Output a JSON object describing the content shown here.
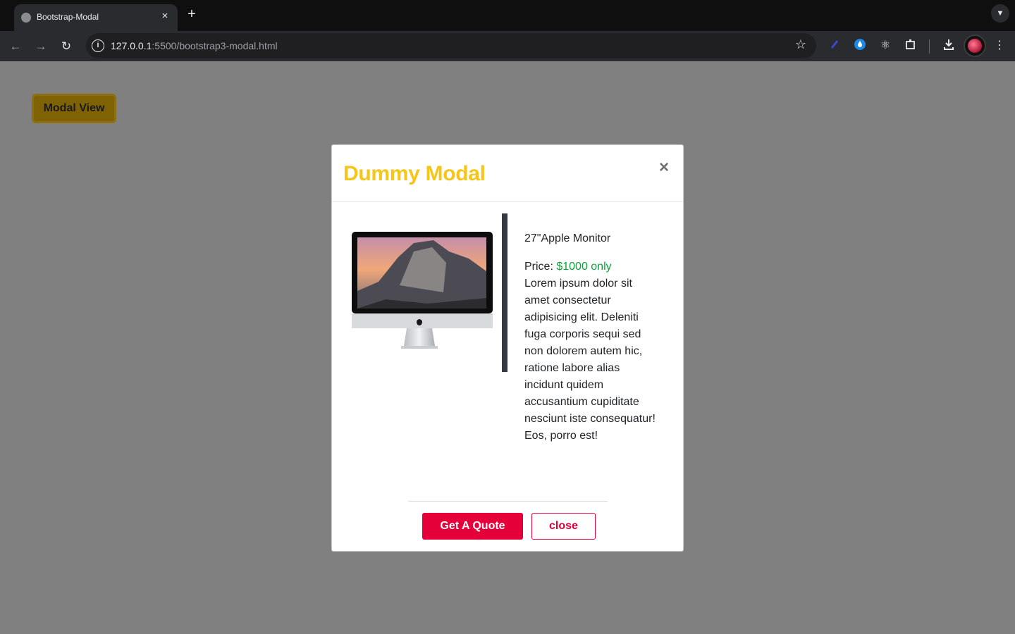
{
  "browser": {
    "tab_title": "Bootstrap-Modal",
    "tab_close": "×",
    "new_tab": "+",
    "url_host": "127.0.0.1",
    "url_rest": ":5500/bootstrap3-modal.html",
    "icons": [
      "back-icon",
      "forward-icon",
      "reload-icon",
      "info-icon",
      "star-icon",
      "pen-extension-icon",
      "drop-extension-icon",
      "react-extension-icon",
      "extensions-puzzle-icon",
      "download-icon",
      "profile-avatar",
      "kebab-menu-icon"
    ]
  },
  "page": {
    "open_button_label": "Modal View"
  },
  "modal": {
    "title": "Dummy Modal",
    "close_x": "×",
    "product_name": "27\"Apple Monitor",
    "price_label": "Price: ",
    "price_value": "$1000 only",
    "description": "Lorem ipsum dolor sit amet consectetur adipisicing elit. Deleniti fuga corporis sequi sed non dolorem autem hic, ratione labore alias incidunt quidem accusantium cupiditate nesciunt iste consequatur! Eos, porro est!",
    "quote_button": "Get A Quote",
    "close_button": "close"
  },
  "colors": {
    "title": "#f5c518",
    "price": "#0ba33a",
    "accent": "#e6003a",
    "overlay": "#808080"
  }
}
